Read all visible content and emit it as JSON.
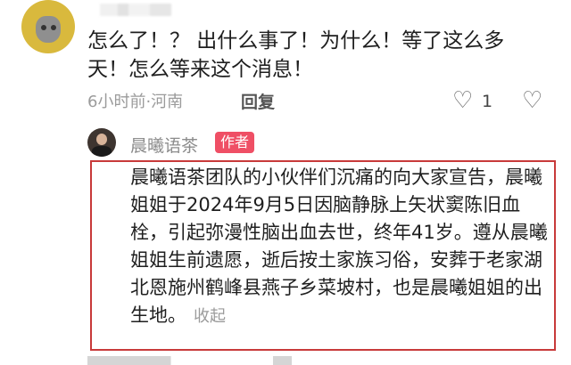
{
  "comment": {
    "text": "怎么了！？ 出什么事了！为什么！等了这么多\n天！怎么等来这个消息！",
    "meta": "6小时前·河南",
    "reply_label": "回复",
    "likes": "1"
  },
  "author_reply": {
    "name": "晨曦语茶",
    "tag": "作者",
    "text": "晨曦语茶团队的小伙伴们沉痛的向大家宣告，晨曦姐姐于2024年9月5日因脑静脉上矢状窦陈旧血栓，引起弥漫性脑出血去世，终年41岁。遵从晨曦姐姐生前遗愿，逝后按土家族习俗，安葬于老家湖北恩施州鹤峰县燕子乡菜坡村，也是晨曦姐姐的出生地。",
    "collapse_label": "收起"
  },
  "icons": {
    "like": "heart-outline-icon",
    "dislike": "broken-heart-icon"
  },
  "colors": {
    "author_tag": "#ef4f65",
    "highlight_border": "#c83a3a"
  }
}
